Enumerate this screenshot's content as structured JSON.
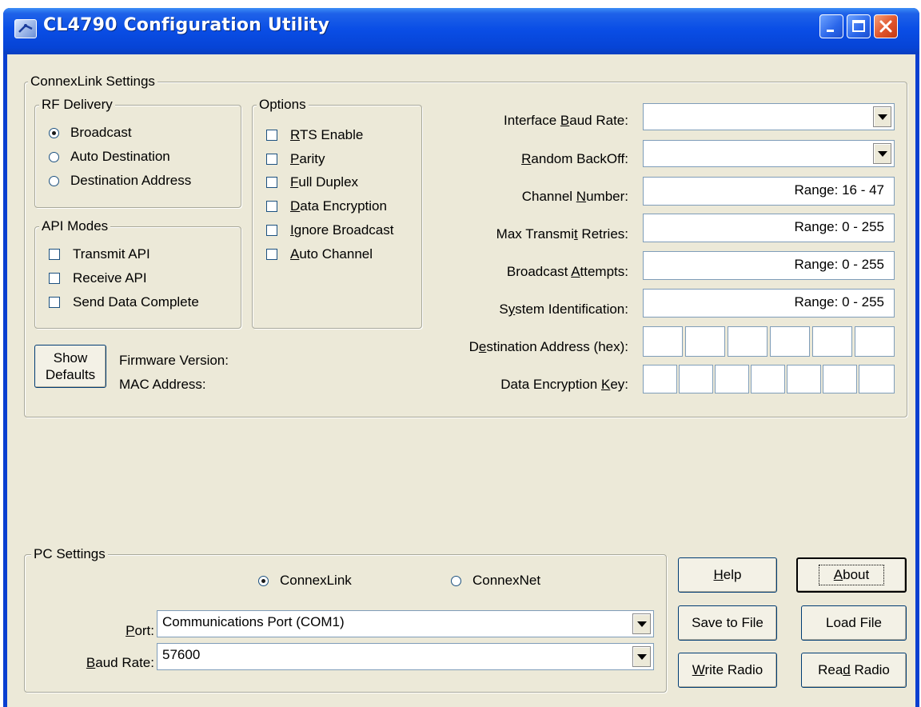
{
  "window": {
    "title": "CL4790 Configuration Utility",
    "controls": [
      "minimize",
      "maximize",
      "close"
    ]
  },
  "connexlink": {
    "group_label": "ConnexLink Settings",
    "rf_delivery": {
      "label": "RF Delivery",
      "options": [
        {
          "label": "Broadcast",
          "selected": true
        },
        {
          "label": "Auto Destination",
          "selected": false
        },
        {
          "label": "Destination Address",
          "selected": false
        }
      ]
    },
    "api_modes": {
      "label": "API Modes",
      "options": [
        {
          "label": "Transmit API",
          "checked": false
        },
        {
          "label": "Receive API",
          "checked": false
        },
        {
          "label": "Send Data Complete",
          "checked": false
        }
      ]
    },
    "options": {
      "label": "Options",
      "items": [
        {
          "pre": "",
          "mn": "R",
          "post": "TS Enable",
          "checked": false
        },
        {
          "pre": "",
          "mn": "P",
          "post": "arity",
          "checked": false
        },
        {
          "pre": "",
          "mn": "F",
          "post": "ull Duplex",
          "checked": false
        },
        {
          "pre": "",
          "mn": "D",
          "post": "ata Encryption",
          "checked": false
        },
        {
          "pre": "",
          "mn": "I",
          "post": "gnore Broadcast",
          "checked": false
        },
        {
          "pre": "",
          "mn": "A",
          "post": "uto Channel",
          "checked": false
        }
      ]
    },
    "show_defaults": {
      "line1": "Show",
      "line2": "Defaults"
    },
    "firmware_version_label": "Firmware Version:",
    "mac_address_label": "MAC Address:",
    "fields": {
      "interface_baud_rate": {
        "pre": "Interface ",
        "mn": "B",
        "post": "aud Rate:",
        "value": ""
      },
      "random_backoff": {
        "pre": "",
        "mn": "R",
        "post": "andom BackOff:",
        "value": ""
      },
      "channel_number": {
        "pre": "Channel ",
        "mn": "N",
        "post": "umber:",
        "value": "Range: 16 - 47"
      },
      "max_transmit_retries": {
        "pre": "Max Transmi",
        "mn": "t",
        "post": " Retries:",
        "value": "Range: 0 - 255"
      },
      "broadcast_attempts": {
        "pre": "Broadcast ",
        "mn": "A",
        "post": "ttempts:",
        "value": "Range: 0 - 255"
      },
      "system_identification": {
        "pre": "S",
        "mn": "y",
        "post": "stem Identification:",
        "value": "Range: 0 - 255"
      },
      "destination_address": {
        "pre": "D",
        "mn": "e",
        "post": "stination Address (hex):",
        "cells": [
          "",
          "",
          "",
          "",
          "",
          ""
        ]
      },
      "data_encryption_key": {
        "pre": "Data Encryption ",
        "mn": "K",
        "post": "ey:",
        "cells": [
          "",
          "",
          "",
          "",
          "",
          "",
          ""
        ]
      }
    }
  },
  "pc_settings": {
    "group_label": "PC Settings",
    "mode_options": [
      {
        "label": "ConnexLink",
        "selected": true
      },
      {
        "label": "ConnexNet",
        "selected": false
      }
    ],
    "port": {
      "pre": "",
      "mn": "P",
      "post": "ort:",
      "value": "Communications Port (COM1)"
    },
    "baud_rate": {
      "pre": "",
      "mn": "B",
      "post": "aud Rate:",
      "value": "57600"
    }
  },
  "buttons": {
    "help": {
      "pre": "",
      "mn": "H",
      "post": "elp"
    },
    "about": {
      "pre": "",
      "mn": "A",
      "post": "bout"
    },
    "save_to_file": {
      "label": "Save to File"
    },
    "load_file": {
      "label": "Load File"
    },
    "write_radio": {
      "pre": "",
      "mn": "W",
      "post": "rite Radio"
    },
    "read_radio": {
      "pre": "Rea",
      "mn": "d",
      "post": " Radio"
    }
  }
}
